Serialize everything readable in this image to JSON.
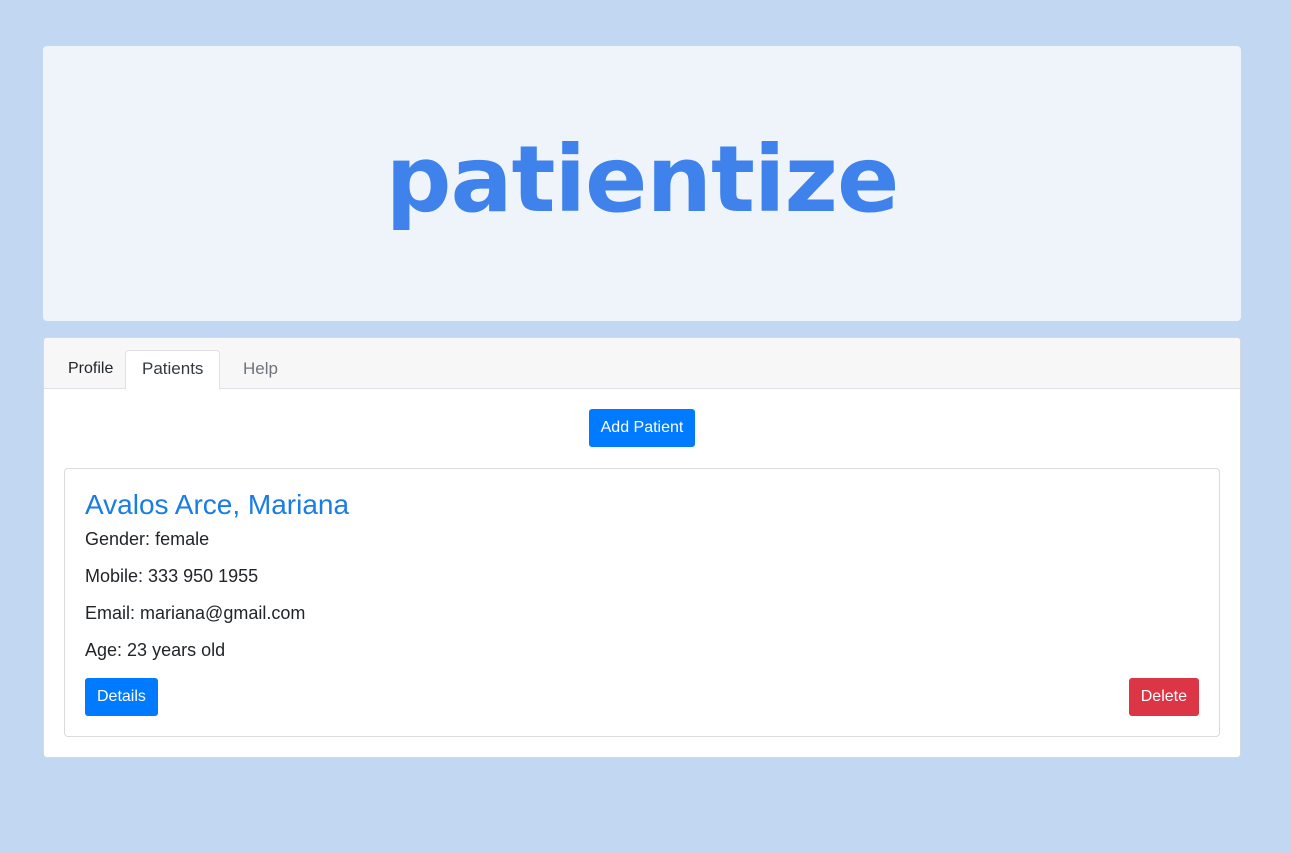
{
  "banner": {
    "logo_text": "patientize",
    "logo_color": "#3f82ec"
  },
  "tabs": [
    {
      "label": "Profile",
      "active": false
    },
    {
      "label": "Patients",
      "active": true
    },
    {
      "label": "Help",
      "active": false
    }
  ],
  "actions": {
    "add_patient_label": "Add Patient"
  },
  "patients": [
    {
      "name": "Avalos Arce, Mariana",
      "gender_label": "Gender:",
      "gender": "female",
      "mobile_label": "Mobile:",
      "mobile": "333 950 1955",
      "email_label": "Email:",
      "email": "mariana@gmail.com",
      "age_label": "Age:",
      "age": "23 years old",
      "details_label": "Details",
      "delete_label": "Delete"
    }
  ],
  "colors": {
    "background": "#c1d7f2",
    "primary": "#007bff",
    "danger": "#dc3545",
    "name_link": "#1a7ce6"
  }
}
